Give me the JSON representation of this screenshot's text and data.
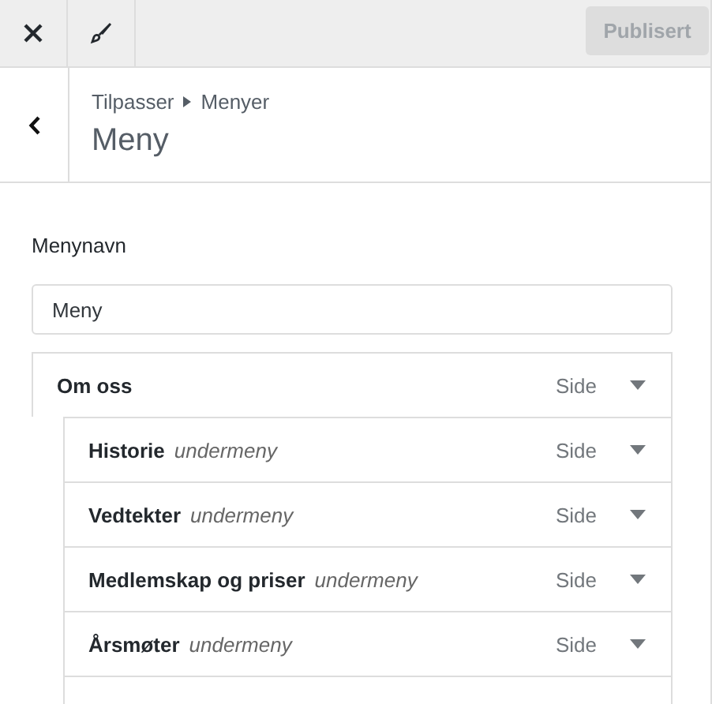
{
  "toolbar": {
    "publish_button": {
      "label": "Publisert",
      "disabled": true
    }
  },
  "header": {
    "breadcrumb": [
      "Tilpasser",
      "Menyer"
    ],
    "title": "Meny"
  },
  "menu_name": {
    "label": "Menynavn",
    "value": "Meny"
  },
  "menu_items": [
    {
      "title": "Om oss",
      "type": "Side",
      "children": [
        {
          "title": "Historie",
          "note": "undermeny",
          "type": "Side"
        },
        {
          "title": "Vedtekter",
          "note": "undermeny",
          "type": "Side"
        },
        {
          "title": "Medlemskap og priser",
          "note": "undermeny",
          "type": "Side"
        },
        {
          "title": "Årsmøter",
          "note": "undermeny",
          "type": "Side"
        }
      ]
    }
  ]
}
